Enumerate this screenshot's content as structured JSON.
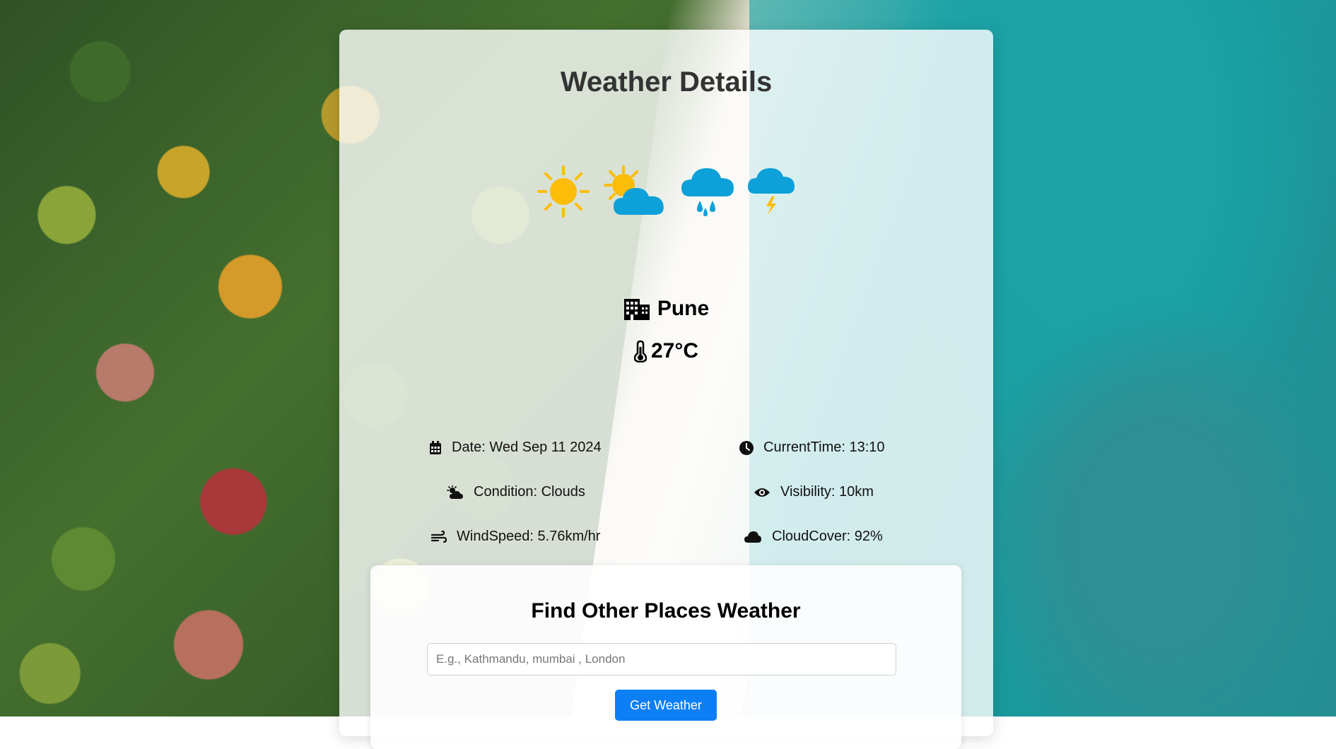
{
  "page": {
    "title": "Weather Details"
  },
  "weather_icons": [
    "sun-icon",
    "partly-cloudy-icon",
    "rain-cloud-icon",
    "thunder-cloud-icon"
  ],
  "current": {
    "city": "Pune",
    "temperature": "27°C"
  },
  "details": {
    "date": "Date: Wed Sep 11 2024",
    "current_time": "CurrentTime: 13:10",
    "condition": "Condition: Clouds",
    "visibility": "Visibility: 10km",
    "wind_speed": "WindSpeed: 5.76km/hr",
    "cloud_cover": "CloudCover: 92%"
  },
  "search": {
    "title": "Find Other Places Weather",
    "placeholder": "E.g., Kathmandu, mumbai , London",
    "value": "",
    "button_label": "Get Weather"
  },
  "colors": {
    "sun": "#fbbd08",
    "cloud": "#0ea0d8",
    "button": "#0d7ff5",
    "title": "#333333"
  }
}
